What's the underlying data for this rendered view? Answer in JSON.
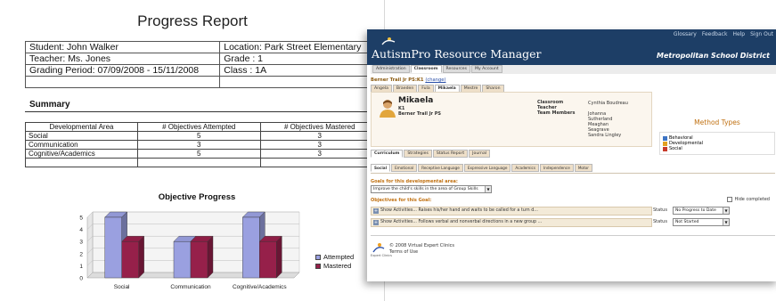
{
  "report": {
    "title": "Progress Report",
    "info": {
      "student": "Student: John Walker",
      "location": "Location: Park Street Elementary",
      "teacher": "Teacher: Ms. Jones",
      "grade": "Grade : 1",
      "grading_period": "Grading Period: 07/09/2008 - 15/11/2008",
      "class": "Class   : 1A"
    },
    "summary_title": "Summary",
    "summary_headers": [
      "Developmental Area",
      "# Objectives Attempted",
      "# Objectives Mastered"
    ],
    "summary_rows": [
      [
        "Social",
        "5",
        "3"
      ],
      [
        "Communication",
        "3",
        "3"
      ],
      [
        "Cognitive/Academics",
        "5",
        "3"
      ]
    ],
    "chart_title": "Objective Progress"
  },
  "chart_data": {
    "type": "bar",
    "title": "Objective Progress",
    "categories": [
      "Social",
      "Communication",
      "Cognitive/Academics"
    ],
    "series": [
      {
        "name": "Attempted",
        "values": [
          5,
          3,
          5
        ],
        "color": "#9aa0e0"
      },
      {
        "name": "Mastered",
        "values": [
          3,
          3,
          3
        ],
        "color": "#96204a"
      }
    ],
    "y_ticks": [
      "0",
      "1",
      "2",
      "3",
      "4",
      "5"
    ],
    "ylim": [
      0,
      5
    ],
    "grid": true,
    "legend": "right",
    "style": "3d"
  },
  "app": {
    "top_links": [
      "Glossary",
      "Feedback",
      "Help",
      "Sign Out"
    ],
    "name": "AutismPro  Resource Manager",
    "district": "Metropolitan School District",
    "main_tabs": [
      "Administration",
      "Classroom",
      "Resources",
      "My Account"
    ],
    "active_main_tab": "Classroom",
    "breadcrumb": "Berner Trail Jr PS:K1",
    "change_link": "(change)",
    "learner_tabs": [
      "Angela",
      "Braeden",
      "Fula",
      "Mikaela",
      "Mestre",
      "Sharon"
    ],
    "active_learner_tab": "Mikaela",
    "learner": {
      "name": "Mikaela",
      "grade": "K1",
      "school": "Berner Trail Jr PS",
      "labels": [
        "Classroom",
        "Teacher",
        "Team Members"
      ],
      "teacher": "Cynthia Boudreau",
      "team": [
        "Johanna",
        "Sutherland",
        "Meaghan",
        "Seagrave",
        "Sandra Lingley"
      ]
    },
    "methods_title": "Method Types",
    "methods": [
      {
        "label": "Behavioral",
        "color": "#3d74c4"
      },
      {
        "label": "Developmental",
        "color": "#e2a020"
      },
      {
        "label": "Social",
        "color": "#c83a2a"
      }
    ],
    "curriculum_tabs": [
      "Curriculum",
      "Strategies",
      "Status Report",
      "Journal"
    ],
    "active_curriculum_tab": "Curriculum",
    "area_tabs": [
      "Social",
      "Emotional",
      "Receptive Language",
      "Expressive Language",
      "Academics",
      "Independence",
      "Motor"
    ],
    "active_area_tab": "Social",
    "goals_label": "Goals for this developmental area:",
    "goal_selected": "Improve the child's skills in the area of Group Skills",
    "objectives_label": "Objectives for this Goal:",
    "hide_completed": "Hide completed",
    "objectives": [
      {
        "text": "Show Activities... Raises his/her hand and waits to be called for a turn d...",
        "status_label": "Status",
        "status": "No Progress to Date"
      },
      {
        "text": "Show Activities... Follows verbal and nonverbal directions in a new group ...",
        "status_label": "Status",
        "status": "Not Started"
      }
    ],
    "footer_logo_text": "Expert Clinics",
    "copyright": "© 2008 Virtual Expert Clinics",
    "terms": "Terms of Use"
  }
}
